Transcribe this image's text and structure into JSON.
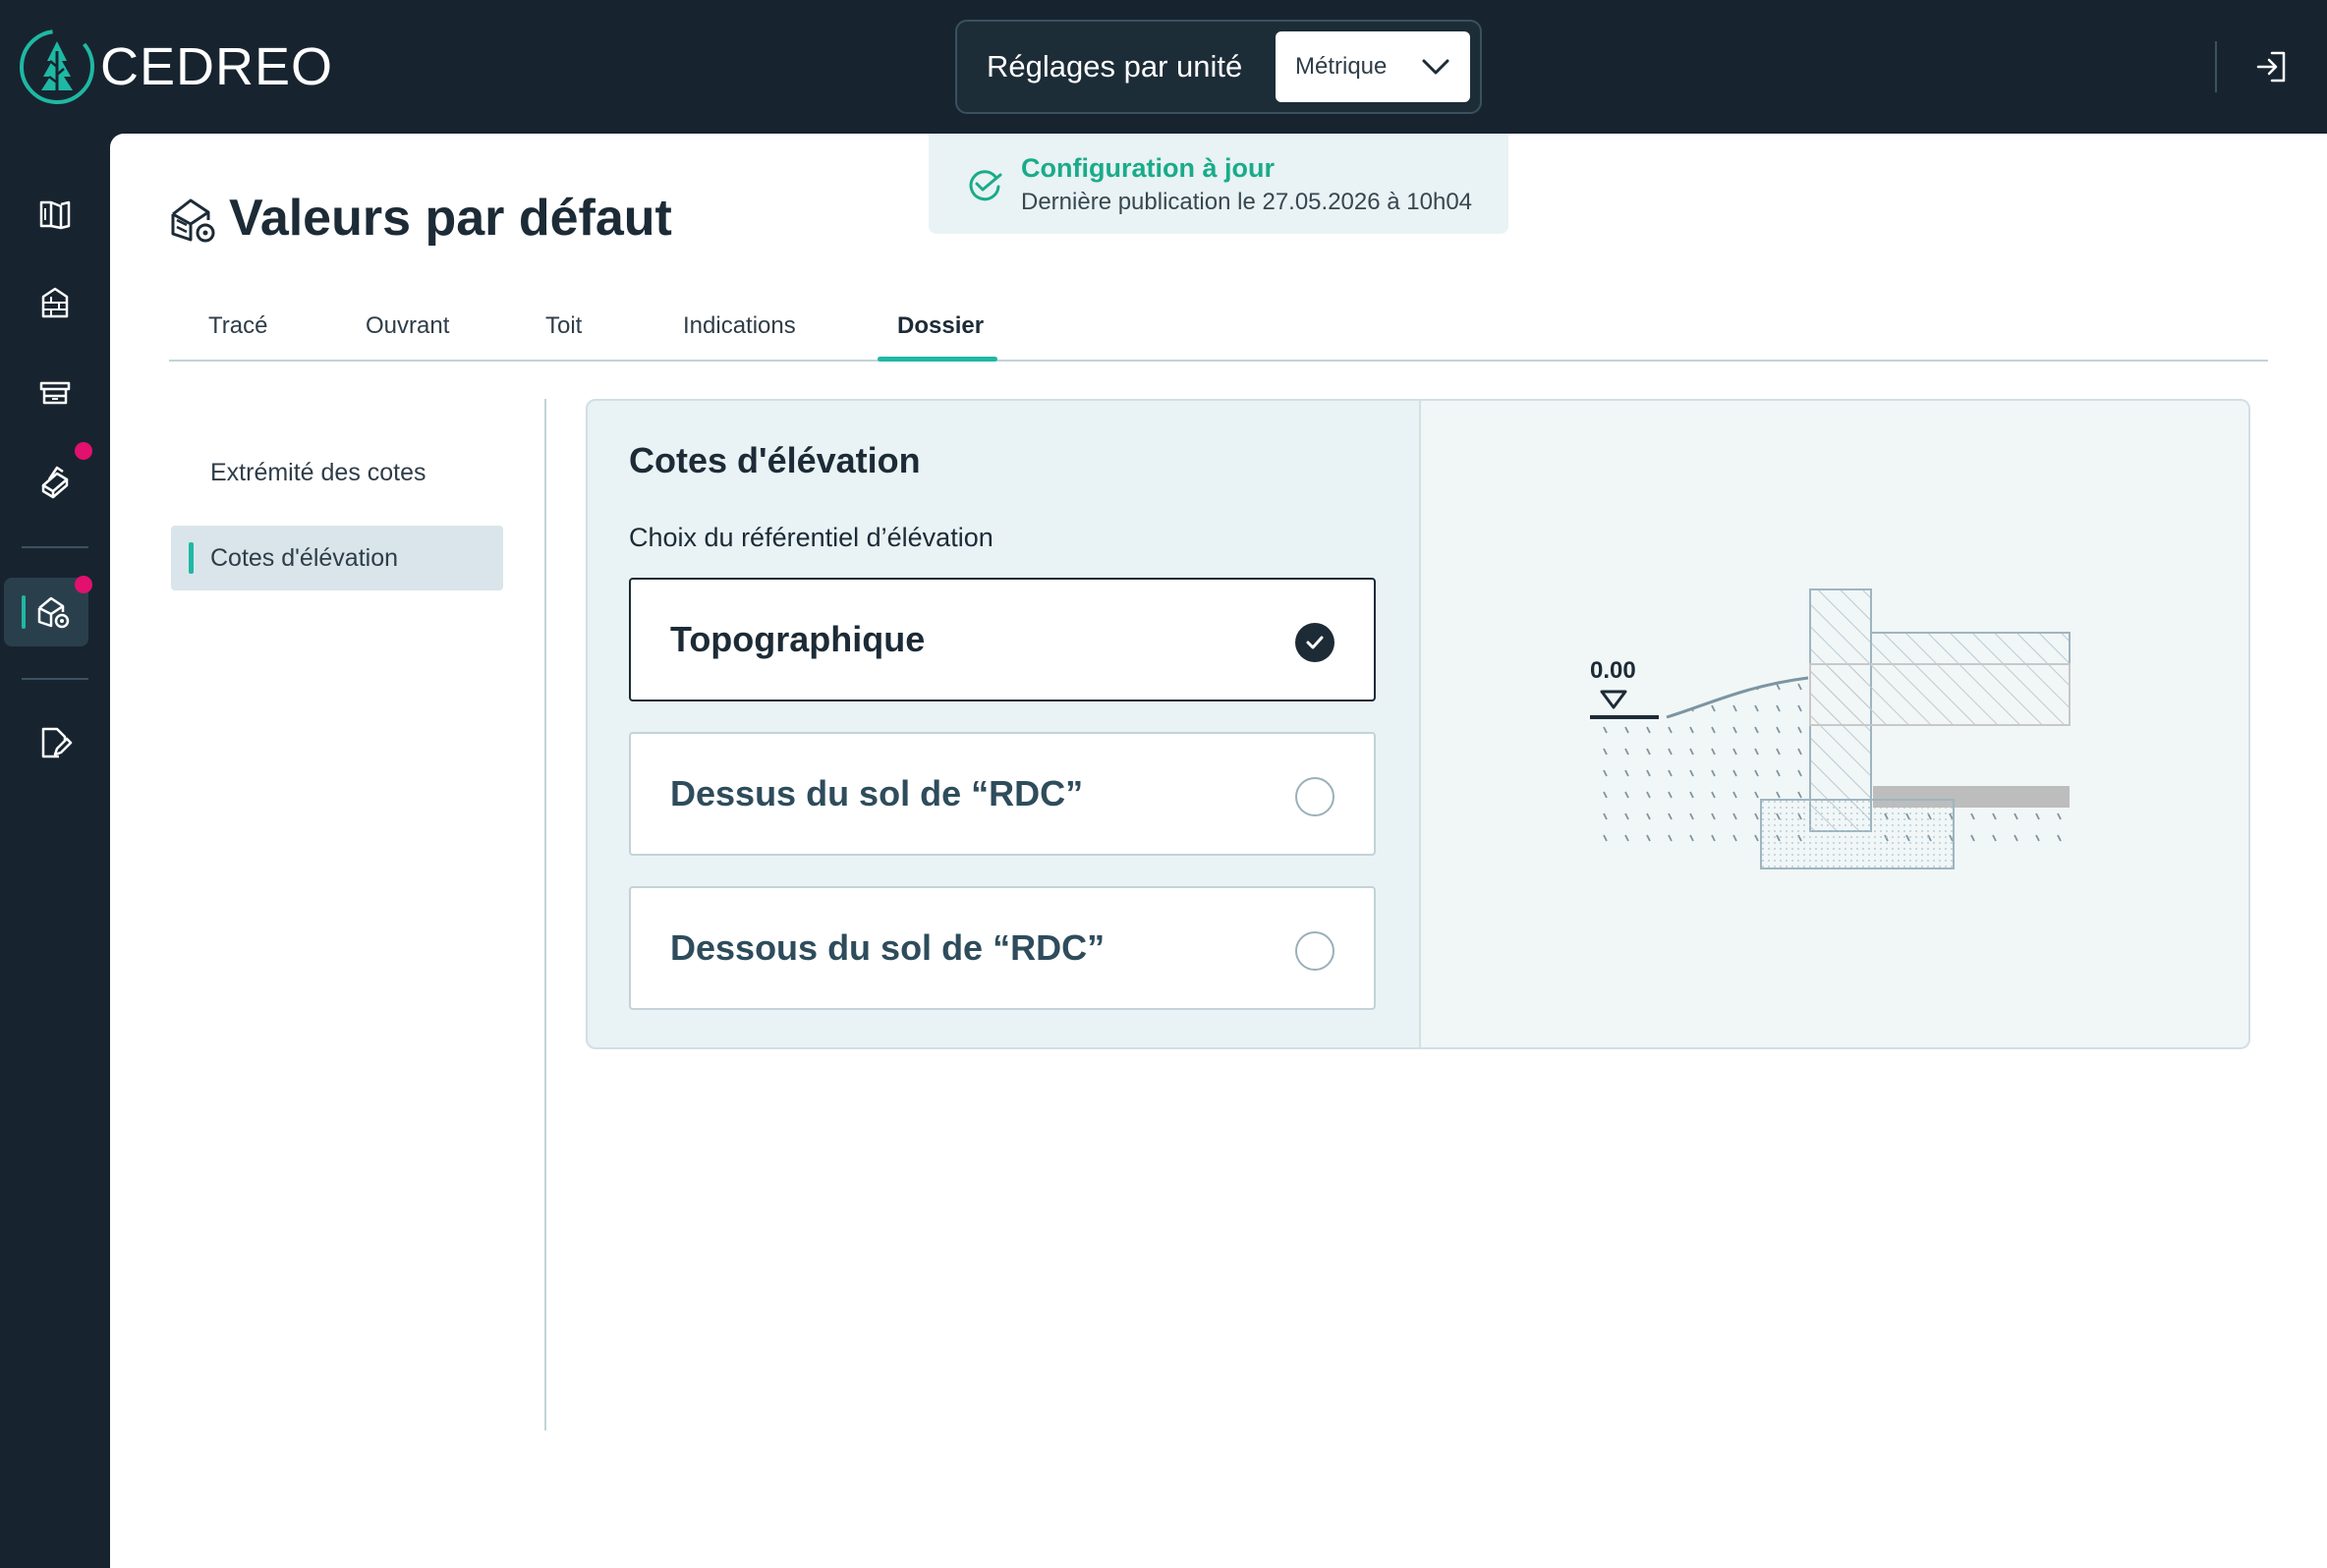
{
  "app": {
    "logo_text": "CEDREO"
  },
  "units": {
    "label": "Réglages par unité",
    "selected": "Métrique"
  },
  "status": {
    "title": "Configuration à jour",
    "subtitle": "Dernière publication le 27.05.2026 à 10h04"
  },
  "page": {
    "title": "Valeurs par défaut"
  },
  "tabs": [
    "Tracé",
    "Ouvrant",
    "Toit",
    "Indications",
    "Dossier"
  ],
  "active_tab": "Dossier",
  "subnav": [
    "Extrémité des cotes",
    "Cotes d'élévation"
  ],
  "active_subnav": "Cotes d'élévation",
  "panel": {
    "title": "Cotes d'élévation",
    "subtitle": "Choix du référentiel d’élévation",
    "options": [
      "Topographique",
      "Dessus du sol de “RDC”",
      "Dessous du sol de “RDC”"
    ],
    "selected_option": "Topographique"
  },
  "diagram": {
    "level_label": "0.00"
  },
  "colors": {
    "accent": "#1fb8a4",
    "dark": "#17242f",
    "badge": "#e2106e",
    "success": "#1aab8a"
  }
}
